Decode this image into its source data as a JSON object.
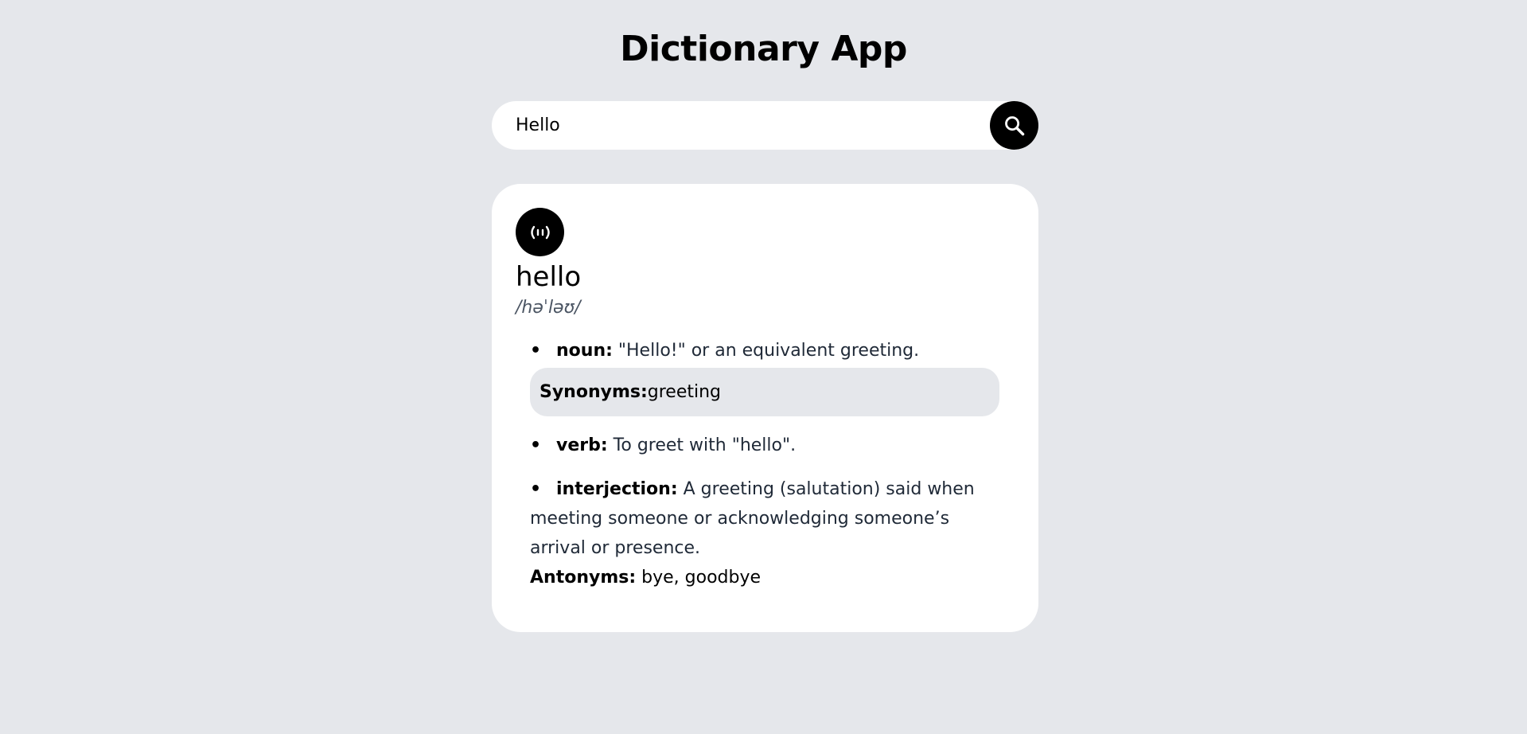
{
  "header": {
    "title": "Dictionary App"
  },
  "search": {
    "value": "Hello",
    "placeholder": "",
    "button_icon": "search-icon"
  },
  "entry": {
    "audio_icon": "audio-waves-icon",
    "word": "hello",
    "phonetic": "/həˈləʊ/",
    "meanings": [
      {
        "bullet": "•",
        "part_of_speech": "noun:",
        "definition": " \"Hello!\" or an equivalent greeting.",
        "synonyms_label": "Synonyms:",
        "synonyms": " greeting"
      },
      {
        "bullet": "•",
        "part_of_speech": "verb:",
        "definition": " To greet with \"hello\"."
      },
      {
        "bullet": "•",
        "part_of_speech": "interjection:",
        "definition": " A greeting (salutation) said when meeting someone or acknowledging someone’s arrival or presence.",
        "antonyms_label": "Antonyms:",
        "antonyms": " bye, goodbye"
      }
    ]
  },
  "colors": {
    "background": "#e5e7eb",
    "card": "#ffffff",
    "accent": "#000000",
    "muted_text": "#4b5563"
  }
}
